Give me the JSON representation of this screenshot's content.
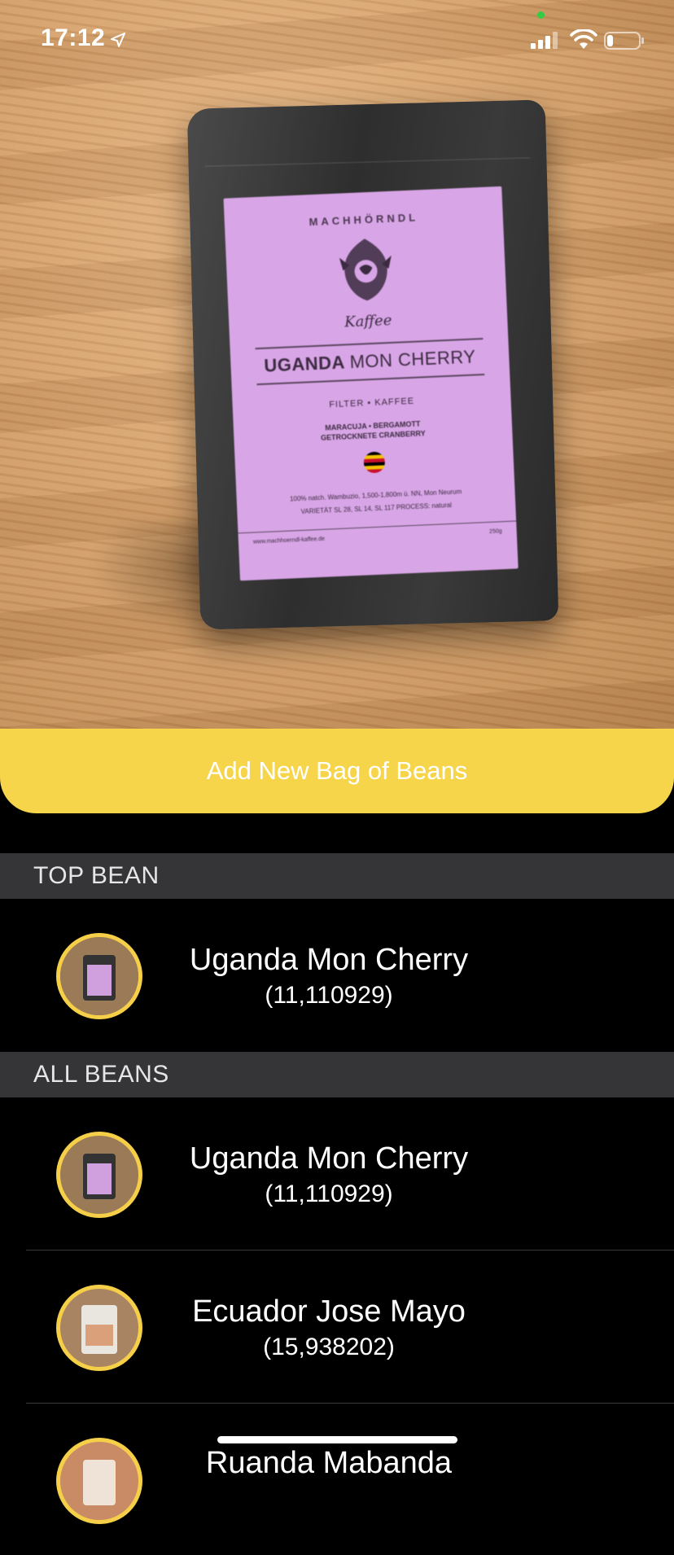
{
  "status_bar": {
    "time": "17:12",
    "colors": {
      "text": "#ffffff",
      "camera_indicator": "#33cc44"
    }
  },
  "photo": {
    "bag_label": {
      "brand_top": "MACHHÖRNDL",
      "brand_script": "Kaffee",
      "title_bold": "UGANDA",
      "title_thin": "MON CHERRY",
      "subtitle": "FILTER • KAFFEE",
      "notes_line1": "MARACUJA • BERGAMOTT",
      "notes_line2": "GETROCKNETE CRANBERRY",
      "details_line1": "100% natch. Wambuzio, 1,500-1,800m ü. NN, Mon Neurum",
      "details_line2": "VARIETÄT SL 28, SL 14, SL 117 PROCESS: natural",
      "footer_left": "www.machhoerndl-kaffee.de",
      "footer_right": "250g"
    }
  },
  "actions": {
    "add_bag_label": "Add New Bag of Beans",
    "button_color": "#f7d54a"
  },
  "sections": {
    "top_bean": {
      "header": "TOP BEAN",
      "items": [
        {
          "name": "Uganda Mon Cherry",
          "score": "(11,110929)",
          "thumb": "purple-label-bag"
        }
      ]
    },
    "all_beans": {
      "header": "ALL BEANS",
      "items": [
        {
          "name": "Uganda Mon Cherry",
          "score": "(11,110929)",
          "thumb": "purple-label-bag"
        },
        {
          "name": "Ecuador Jose Mayo",
          "score": "(15,938202)",
          "thumb": "white-label-bag"
        },
        {
          "name": "Ruanda Mabanda",
          "score": "",
          "thumb": "orange-label-bag"
        }
      ]
    }
  },
  "theme": {
    "background": "#000000",
    "section_header_bg": "#353538",
    "avatar_ring": "#f5cf48"
  }
}
